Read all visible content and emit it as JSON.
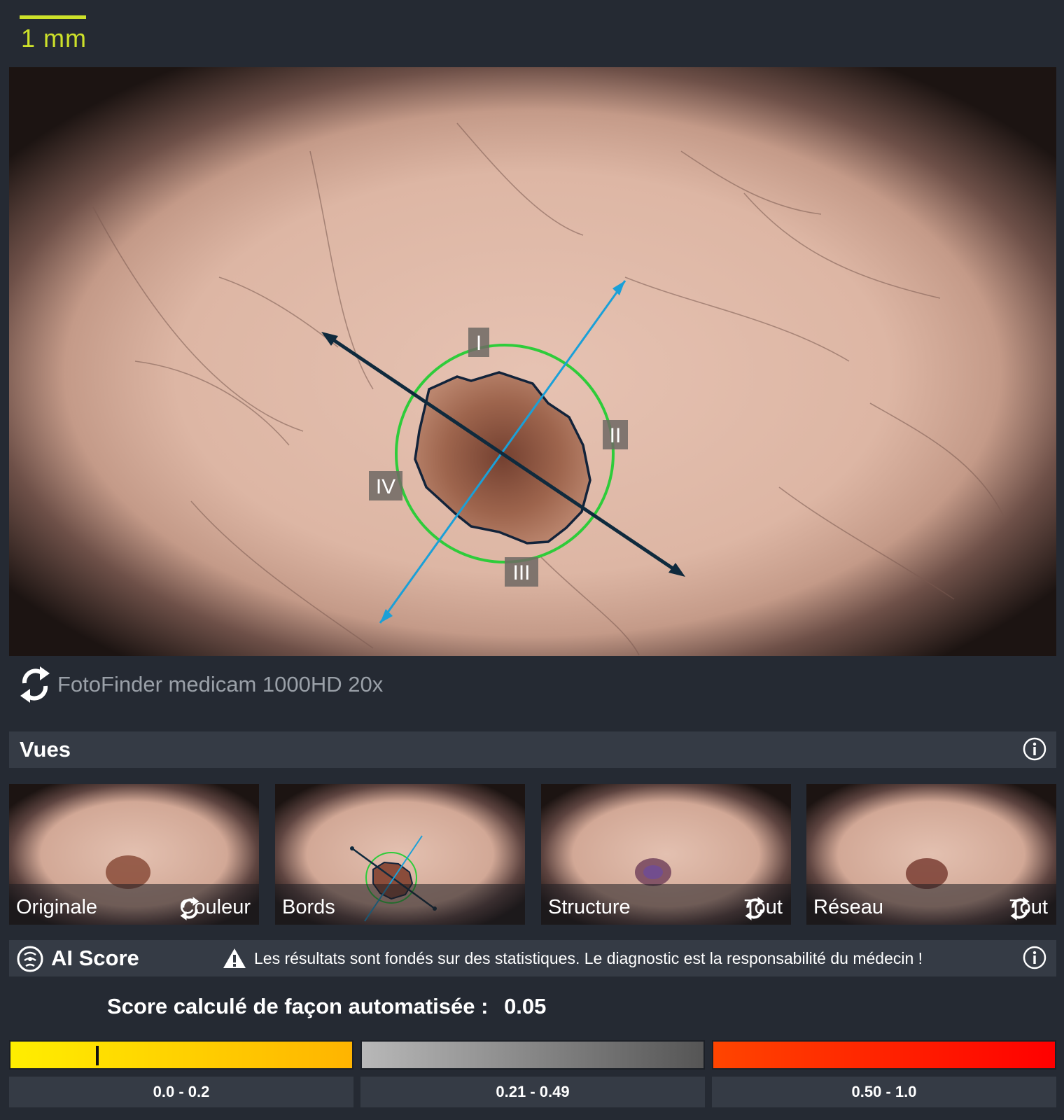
{
  "scale": {
    "label": "1 mm"
  },
  "main_image": {
    "quadrant_labels": [
      "I",
      "II",
      "III",
      "IV"
    ],
    "colors": {
      "border_outline": "#12233a",
      "circle": "#2ecc3a",
      "axis_long": "#0f2a3d",
      "axis_short": "#1aa0d8"
    }
  },
  "device": {
    "label": "FotoFinder medicam 1000HD 20x",
    "icon": "refresh-icon"
  },
  "views": {
    "title": "Vues",
    "info_icon": "info-icon",
    "thumbnails": [
      {
        "left": "Originale",
        "right": "Couleur",
        "has_cycle": true
      },
      {
        "left": "Bords",
        "right": "",
        "has_cycle": false
      },
      {
        "left": "Structure",
        "right": "Tout",
        "has_cycle": true
      },
      {
        "left": "Réseau",
        "right": "Tout",
        "has_cycle": true
      }
    ]
  },
  "ai": {
    "title": "AI Score",
    "warning": "Les résultats sont fondés sur des statistiques. Le diagnostic est la responsabilité du médecin !",
    "score_label": "Score calculé de façon automatisée :",
    "score_value": "0.05",
    "score_numeric": 0.05,
    "ranges": [
      {
        "label": "0.0 - 0.2",
        "min": 0.0,
        "max": 0.2
      },
      {
        "label": "0.21 - 0.49",
        "min": 0.21,
        "max": 0.49
      },
      {
        "label": "0.50 - 1.0",
        "min": 0.5,
        "max": 1.0
      }
    ]
  }
}
